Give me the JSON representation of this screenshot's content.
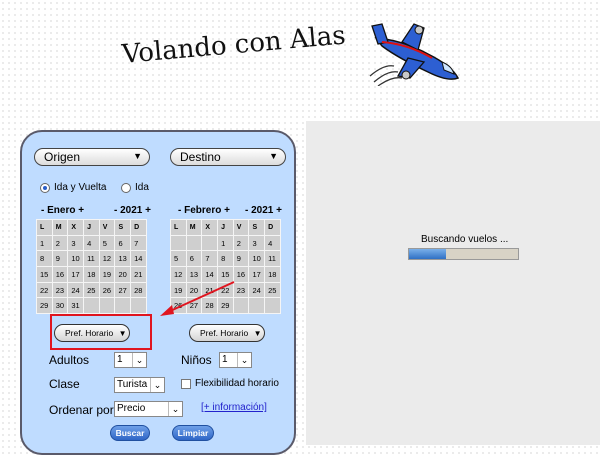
{
  "site": {
    "title": "Volando con Alas",
    "logo_icon": "airplane-icon"
  },
  "form": {
    "origin_label": "Origen",
    "destination_label": "Destino",
    "trip_type": {
      "options": [
        "Ida y Vuelta",
        "Ida"
      ],
      "selected": "Ida y Vuelta"
    },
    "calendars": [
      {
        "prev": "-",
        "month": "Enero",
        "next": "+",
        "year_prev": "-",
        "year": "2021",
        "year_next": "+",
        "weekdays": [
          "L",
          "M",
          "X",
          "J",
          "V",
          "S",
          "D"
        ],
        "weeks": [
          [
            "1",
            "2",
            "3",
            "4",
            "5",
            "6",
            "7"
          ],
          [
            "8",
            "9",
            "10",
            "11",
            "12",
            "13",
            "14"
          ],
          [
            "15",
            "16",
            "17",
            "18",
            "19",
            "20",
            "21"
          ],
          [
            "22",
            "23",
            "24",
            "25",
            "26",
            "27",
            "28"
          ],
          [
            "29",
            "30",
            "31",
            "",
            "",
            "",
            ""
          ]
        ]
      },
      {
        "prev": "-",
        "month": "Febrero",
        "next": "+",
        "year_prev": "-",
        "year": "2021",
        "year_next": "+",
        "weekdays": [
          "L",
          "M",
          "X",
          "J",
          "V",
          "S",
          "D"
        ],
        "weeks": [
          [
            "",
            "",
            "",
            "1",
            "2",
            "3",
            "4"
          ],
          [
            "5",
            "6",
            "7",
            "8",
            "9",
            "10",
            "11"
          ],
          [
            "12",
            "13",
            "14",
            "15",
            "16",
            "17",
            "18"
          ],
          [
            "19",
            "20",
            "21",
            "22",
            "23",
            "24",
            "25"
          ],
          [
            "26",
            "27",
            "28",
            "29",
            "",
            "",
            ""
          ]
        ]
      }
    ],
    "pref_horario_label": "Pref. Horario",
    "adults_label": "Adultos",
    "adults_value": "1",
    "children_label": "Niños",
    "children_value": "1",
    "class_label": "Clase",
    "class_value": "Turista",
    "flex_label": "Flexibilidad horario",
    "flex_checked": false,
    "order_label": "Ordenar por:",
    "order_value": "Precio",
    "info_link": "[+ información]",
    "search_button": "Buscar",
    "clear_button": "Limpiar"
  },
  "status": {
    "searching_text": "Buscando vuelos ...",
    "progress_fraction": 0.34
  },
  "colors": {
    "panel_bg": "#bfdcff",
    "highlight": "#e0151f",
    "accent": "#2f66c6"
  }
}
